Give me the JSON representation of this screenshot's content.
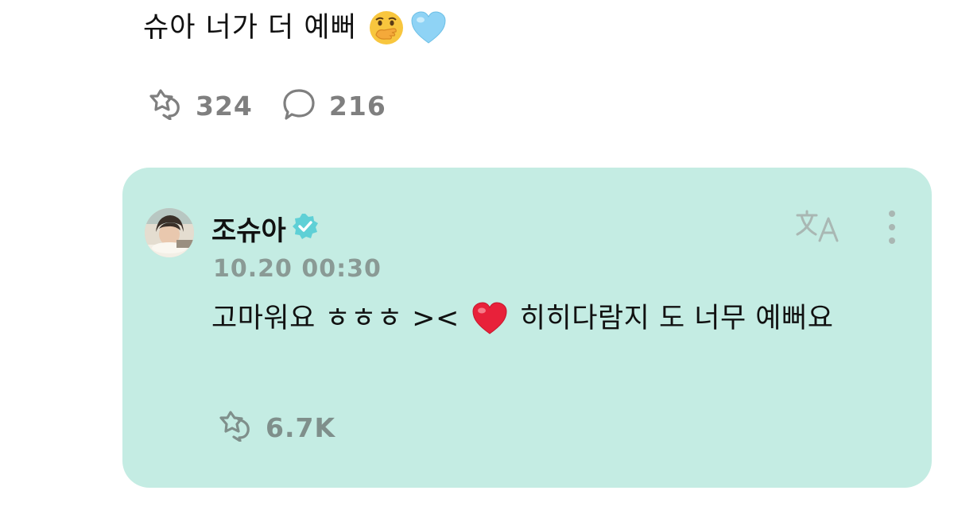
{
  "post": {
    "text": "슈아 너가 더 예뻐",
    "emojis": [
      "hand-over-mouth-emoji",
      "light-blue-heart-emoji"
    ],
    "like_count": "324",
    "comment_count": "216",
    "icons": {
      "like": "star-bubble-icon",
      "comment": "comment-bubble-icon"
    }
  },
  "reply": {
    "author": "조슈아",
    "verified": true,
    "timestamp": "10.20 00:30",
    "text_before": "고마워요 ㅎㅎㅎ ><",
    "text_after": "히히다람지 도 너무 예뻐요",
    "emoji": "red-heart-emoji",
    "like_count": "6.7K",
    "icons": {
      "translate": "translate-icon",
      "more": "more-vertical-icon",
      "like": "star-bubble-icon"
    }
  },
  "colors": {
    "reply_background": "#c4ece3",
    "verified_badge": "#5fd0d6",
    "muted_text": "#7f7f7f",
    "timestamp_text": "#8a9a95"
  }
}
